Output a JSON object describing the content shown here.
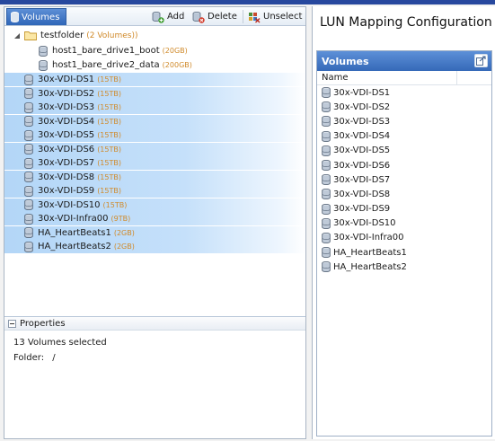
{
  "toolbar": {
    "tab_label": "Volumes",
    "add_label": "Add",
    "delete_label": "Delete",
    "unselect_label": "Unselect"
  },
  "tree": {
    "folder": {
      "name": "testfolder",
      "count": "(2 Volumes))"
    },
    "children": [
      {
        "name": "host1_bare_drive1_boot",
        "size": "(20GB)"
      },
      {
        "name": "host1_bare_drive2_data",
        "size": "(200GB)"
      }
    ],
    "volumes": [
      {
        "name": "30x-VDI-DS1",
        "size": "(15TB)"
      },
      {
        "name": "30x-VDI-DS2",
        "size": "(15TB)"
      },
      {
        "name": "30x-VDI-DS3",
        "size": "(15TB)"
      },
      {
        "name": "30x-VDI-DS4",
        "size": "(15TB)"
      },
      {
        "name": "30x-VDI-DS5",
        "size": "(15TB)"
      },
      {
        "name": "30x-VDI-DS6",
        "size": "(15TB)"
      },
      {
        "name": "30x-VDI-DS7",
        "size": "(15TB)"
      },
      {
        "name": "30x-VDI-DS8",
        "size": "(15TB)"
      },
      {
        "name": "30x-VDI-DS9",
        "size": "(15TB)"
      },
      {
        "name": "30x-VDI-DS10",
        "size": "(15TB)"
      },
      {
        "name": "30x-VDI-Infra00",
        "size": "(9TB)"
      },
      {
        "name": "HA_HeartBeats1",
        "size": "(2GB)"
      },
      {
        "name": "HA_HeartBeats2",
        "size": "(2GB)"
      }
    ]
  },
  "properties": {
    "header": "Properties",
    "summary": "13 Volumes selected",
    "folder_label": "Folder:",
    "folder_value": "/"
  },
  "lun": {
    "title": "LUN Mapping Configuration",
    "panel_title": "Volumes",
    "column_name": "Name",
    "rows": [
      "30x-VDI-DS1",
      "30x-VDI-DS2",
      "30x-VDI-DS3",
      "30x-VDI-DS4",
      "30x-VDI-DS5",
      "30x-VDI-DS6",
      "30x-VDI-DS7",
      "30x-VDI-DS8",
      "30x-VDI-DS9",
      "30x-VDI-DS10",
      "30x-VDI-Infra00",
      "HA_HeartBeats1",
      "HA_HeartBeats2"
    ]
  },
  "colors": {
    "accent": "#3569b8",
    "selection": "#c5e0fa",
    "size_text": "#d08a2a"
  },
  "icons": {
    "volume": "database-icon",
    "folder": "folder-icon",
    "add": "add-volume-icon",
    "delete": "delete-volume-icon",
    "unselect": "unselect-icon",
    "export": "export-icon"
  }
}
